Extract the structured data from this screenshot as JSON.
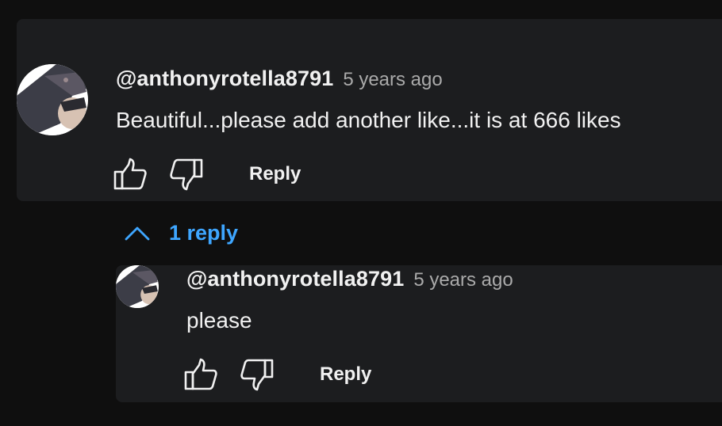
{
  "comment": {
    "author": "@anthonyrotella8791",
    "time": "5 years ago",
    "text": "Beautiful...please add another like...it is at 666 likes",
    "actions": {
      "like_icon": "thumbs-up-icon",
      "dislike_icon": "thumbs-down-icon",
      "reply_label": "Reply"
    }
  },
  "replies_toggle": {
    "icon": "chevron-up-icon",
    "label": "1 reply"
  },
  "reply": {
    "author": "@anthonyrotella8791",
    "time": "5 years ago",
    "text": "please",
    "actions": {
      "like_icon": "thumbs-up-icon",
      "dislike_icon": "thumbs-down-icon",
      "reply_label": "Reply"
    }
  },
  "colors": {
    "background": "#0f0f0f",
    "card": "#1c1d1f",
    "text_primary": "#f1f1f1",
    "text_secondary": "#aaaaaa",
    "link_blue": "#3ea6ff"
  }
}
